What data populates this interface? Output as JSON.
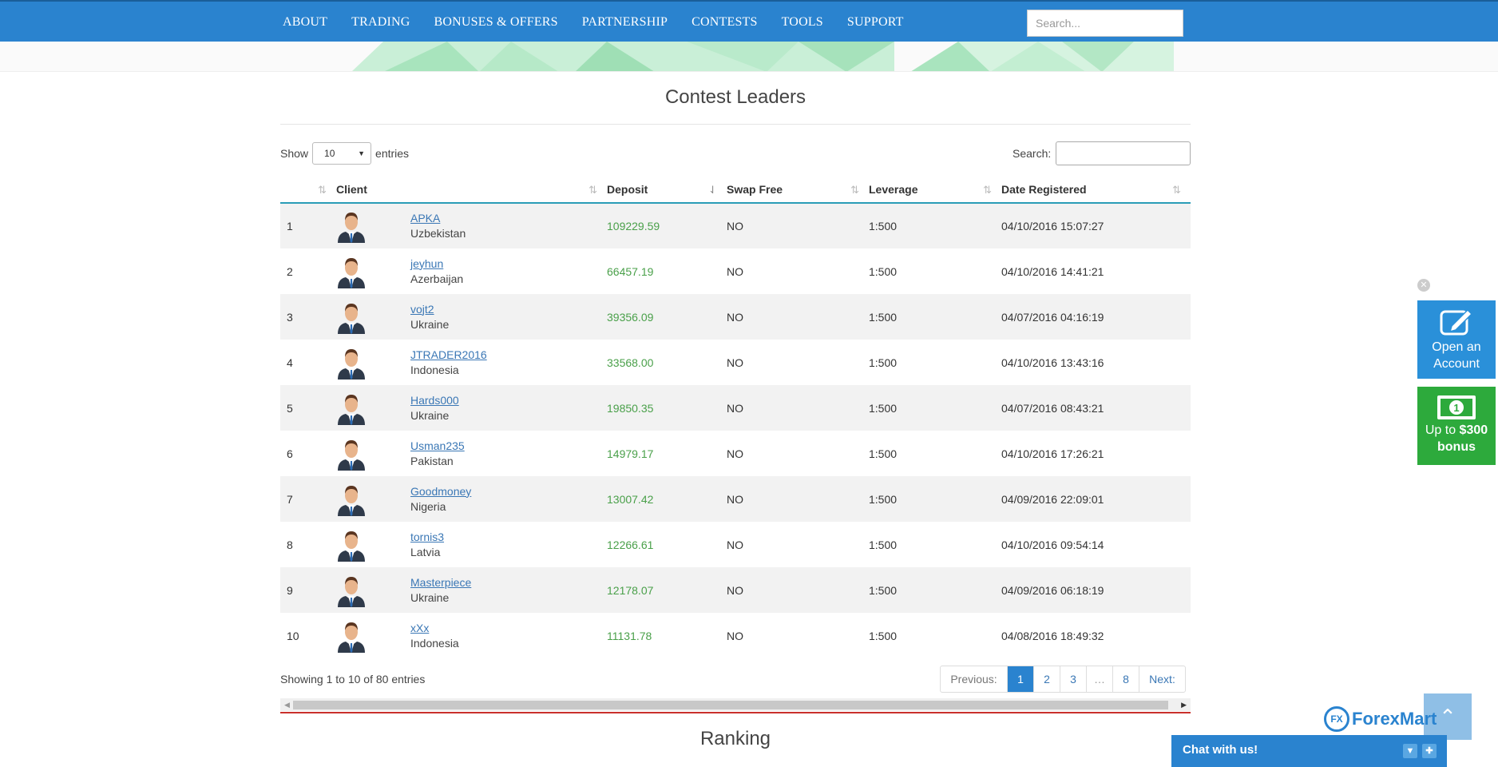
{
  "nav": {
    "items": [
      "ABOUT",
      "TRADING",
      "BONUSES & OFFERS",
      "PARTNERSHIP",
      "CONTESTS",
      "TOOLS",
      "SUPPORT"
    ],
    "search_placeholder": "Search..."
  },
  "section": {
    "title": "Contest Leaders",
    "show_label": "Show",
    "entries_label": "entries",
    "page_length": "10",
    "search_label": "Search:"
  },
  "table": {
    "headers": [
      "",
      "Client",
      "Deposit",
      "Swap Free",
      "Leverage",
      "Date Registered"
    ],
    "rows": [
      {
        "rank": "1",
        "name": "APKA",
        "country": "Uzbekistan",
        "deposit": "109229.59",
        "swap": "NO",
        "leverage": "1:500",
        "date": "04/10/2016 15:07:27"
      },
      {
        "rank": "2",
        "name": "jeyhun",
        "country": "Azerbaijan",
        "deposit": "66457.19",
        "swap": "NO",
        "leverage": "1:500",
        "date": "04/10/2016 14:41:21"
      },
      {
        "rank": "3",
        "name": "vojt2",
        "country": "Ukraine",
        "deposit": "39356.09",
        "swap": "NO",
        "leverage": "1:500",
        "date": "04/07/2016 04:16:19"
      },
      {
        "rank": "4",
        "name": "JTRADER2016",
        "country": "Indonesia",
        "deposit": "33568.00",
        "swap": "NO",
        "leverage": "1:500",
        "date": "04/10/2016 13:43:16"
      },
      {
        "rank": "5",
        "name": "Hards000",
        "country": "Ukraine",
        "deposit": "19850.35",
        "swap": "NO",
        "leverage": "1:500",
        "date": "04/07/2016 08:43:21"
      },
      {
        "rank": "6",
        "name": "Usman235",
        "country": "Pakistan",
        "deposit": "14979.17",
        "swap": "NO",
        "leverage": "1:500",
        "date": "04/10/2016 17:26:21"
      },
      {
        "rank": "7",
        "name": "Goodmoney",
        "country": "Nigeria",
        "deposit": "13007.42",
        "swap": "NO",
        "leverage": "1:500",
        "date": "04/09/2016 22:09:01"
      },
      {
        "rank": "8",
        "name": "tornis3",
        "country": "Latvia",
        "deposit": "12266.61",
        "swap": "NO",
        "leverage": "1:500",
        "date": "04/10/2016 09:54:14"
      },
      {
        "rank": "9",
        "name": "Masterpiece",
        "country": "Ukraine",
        "deposit": "12178.07",
        "swap": "NO",
        "leverage": "1:500",
        "date": "04/09/2016 06:18:19"
      },
      {
        "rank": "10",
        "name": "xXx",
        "country": "Indonesia",
        "deposit": "11131.78",
        "swap": "NO",
        "leverage": "1:500",
        "date": "04/08/2016 18:49:32"
      }
    ]
  },
  "footer": {
    "showing": "Showing 1 to 10 of 80 entries",
    "pager": {
      "prev": "Previous:",
      "pages": [
        "1",
        "2",
        "3",
        "…",
        "8"
      ],
      "next": "Next:",
      "current": "1"
    },
    "next_title": "Ranking"
  },
  "widgets": {
    "open_account": [
      "Open an",
      "Account"
    ],
    "bonus_pre": "Up to ",
    "bonus_amount": "$300",
    "bonus_post": "bonus",
    "logo": "ForexMart",
    "logo_badge": "FX",
    "chat": "Chat with us!"
  },
  "colors": {
    "nav_bg": "#2a83cf",
    "header_underline": "#2a9cb7",
    "deposit_green": "#4aa04a",
    "link_blue": "#3a77b5",
    "bonus_green": "#2daa3c"
  },
  "icons": [
    "search-icon",
    "sort-icon",
    "avatar-icon",
    "edit-icon",
    "money-icon",
    "close-icon",
    "arrow-up-icon",
    "chevron-down-icon",
    "plus-icon"
  ]
}
